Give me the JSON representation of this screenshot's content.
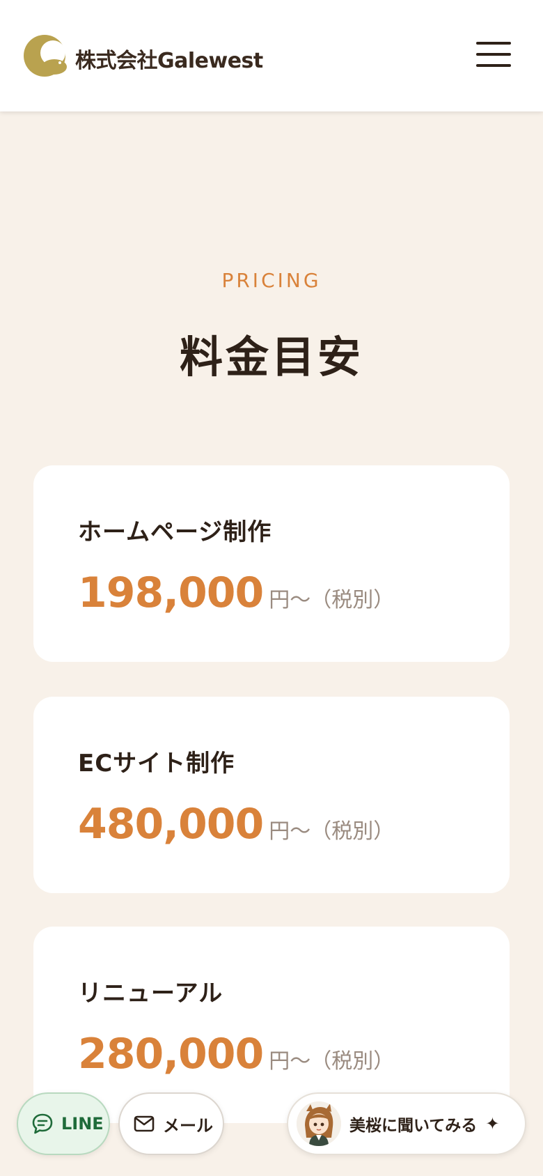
{
  "header": {
    "company_name": "株式会社Galewest",
    "logo_icon": "seal-logo-icon",
    "menu_icon": "hamburger-menu-icon"
  },
  "pricing": {
    "eyebrow": "PRICING",
    "title": "料金目安",
    "items": [
      {
        "label": "ホームページ制作",
        "price": "198,000",
        "suffix": "円〜（税別）"
      },
      {
        "label": "ECサイト制作",
        "price": "480,000",
        "suffix": "円〜（税別）"
      },
      {
        "label": "リニューアル",
        "price": "280,000",
        "suffix": "円〜（税別）"
      }
    ]
  },
  "floating_buttons": {
    "line": {
      "label": "LINE",
      "icon": "chat-bubble-icon"
    },
    "mail": {
      "label": "メール",
      "icon": "envelope-icon"
    },
    "ask": {
      "label": "美桜に聞いてみる",
      "icon": "sparkle-icon",
      "avatar": "character-avatar"
    }
  },
  "colors": {
    "accent": "#d9823a",
    "background": "#f8f1e9",
    "text": "#2e2118",
    "logo_gold": "#b9a24f",
    "line_green": "#1f6b3a"
  }
}
